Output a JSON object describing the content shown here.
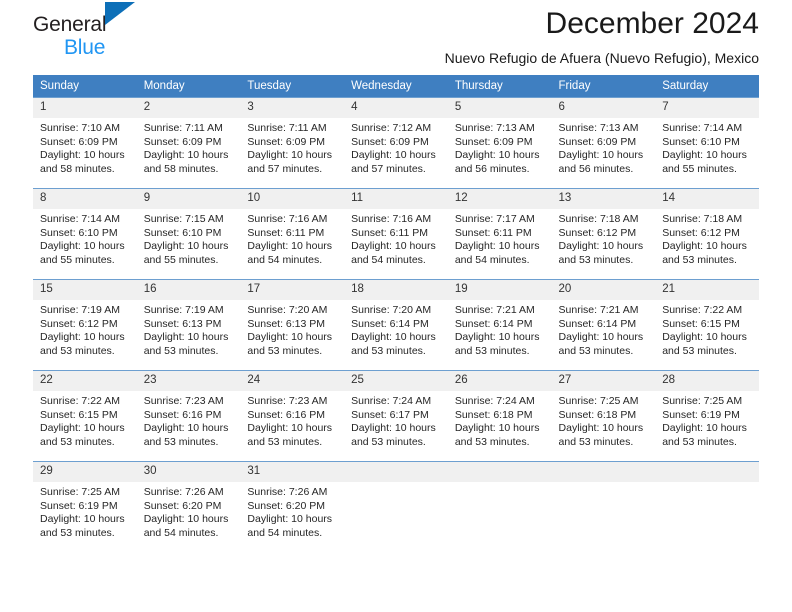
{
  "brand": {
    "line1": "General",
    "line2": "Blue",
    "accent_color": "#0d6fb8",
    "blue_color": "#2196f3"
  },
  "header": {
    "title": "December 2024",
    "subtitle": "Nuevo Refugio de Afuera (Nuevo Refugio), Mexico"
  },
  "calendar": {
    "header_color": "#3f7fc1",
    "weekday_headers": [
      "Sunday",
      "Monday",
      "Tuesday",
      "Wednesday",
      "Thursday",
      "Friday",
      "Saturday"
    ],
    "weeks": [
      [
        {
          "day": "1",
          "sunrise": "Sunrise: 7:10 AM",
          "sunset": "Sunset: 6:09 PM",
          "daylight": "Daylight: 10 hours and 58 minutes."
        },
        {
          "day": "2",
          "sunrise": "Sunrise: 7:11 AM",
          "sunset": "Sunset: 6:09 PM",
          "daylight": "Daylight: 10 hours and 58 minutes."
        },
        {
          "day": "3",
          "sunrise": "Sunrise: 7:11 AM",
          "sunset": "Sunset: 6:09 PM",
          "daylight": "Daylight: 10 hours and 57 minutes."
        },
        {
          "day": "4",
          "sunrise": "Sunrise: 7:12 AM",
          "sunset": "Sunset: 6:09 PM",
          "daylight": "Daylight: 10 hours and 57 minutes."
        },
        {
          "day": "5",
          "sunrise": "Sunrise: 7:13 AM",
          "sunset": "Sunset: 6:09 PM",
          "daylight": "Daylight: 10 hours and 56 minutes."
        },
        {
          "day": "6",
          "sunrise": "Sunrise: 7:13 AM",
          "sunset": "Sunset: 6:09 PM",
          "daylight": "Daylight: 10 hours and 56 minutes."
        },
        {
          "day": "7",
          "sunrise": "Sunrise: 7:14 AM",
          "sunset": "Sunset: 6:10 PM",
          "daylight": "Daylight: 10 hours and 55 minutes."
        }
      ],
      [
        {
          "day": "8",
          "sunrise": "Sunrise: 7:14 AM",
          "sunset": "Sunset: 6:10 PM",
          "daylight": "Daylight: 10 hours and 55 minutes."
        },
        {
          "day": "9",
          "sunrise": "Sunrise: 7:15 AM",
          "sunset": "Sunset: 6:10 PM",
          "daylight": "Daylight: 10 hours and 55 minutes."
        },
        {
          "day": "10",
          "sunrise": "Sunrise: 7:16 AM",
          "sunset": "Sunset: 6:11 PM",
          "daylight": "Daylight: 10 hours and 54 minutes."
        },
        {
          "day": "11",
          "sunrise": "Sunrise: 7:16 AM",
          "sunset": "Sunset: 6:11 PM",
          "daylight": "Daylight: 10 hours and 54 minutes."
        },
        {
          "day": "12",
          "sunrise": "Sunrise: 7:17 AM",
          "sunset": "Sunset: 6:11 PM",
          "daylight": "Daylight: 10 hours and 54 minutes."
        },
        {
          "day": "13",
          "sunrise": "Sunrise: 7:18 AM",
          "sunset": "Sunset: 6:12 PM",
          "daylight": "Daylight: 10 hours and 53 minutes."
        },
        {
          "day": "14",
          "sunrise": "Sunrise: 7:18 AM",
          "sunset": "Sunset: 6:12 PM",
          "daylight": "Daylight: 10 hours and 53 minutes."
        }
      ],
      [
        {
          "day": "15",
          "sunrise": "Sunrise: 7:19 AM",
          "sunset": "Sunset: 6:12 PM",
          "daylight": "Daylight: 10 hours and 53 minutes."
        },
        {
          "day": "16",
          "sunrise": "Sunrise: 7:19 AM",
          "sunset": "Sunset: 6:13 PM",
          "daylight": "Daylight: 10 hours and 53 minutes."
        },
        {
          "day": "17",
          "sunrise": "Sunrise: 7:20 AM",
          "sunset": "Sunset: 6:13 PM",
          "daylight": "Daylight: 10 hours and 53 minutes."
        },
        {
          "day": "18",
          "sunrise": "Sunrise: 7:20 AM",
          "sunset": "Sunset: 6:14 PM",
          "daylight": "Daylight: 10 hours and 53 minutes."
        },
        {
          "day": "19",
          "sunrise": "Sunrise: 7:21 AM",
          "sunset": "Sunset: 6:14 PM",
          "daylight": "Daylight: 10 hours and 53 minutes."
        },
        {
          "day": "20",
          "sunrise": "Sunrise: 7:21 AM",
          "sunset": "Sunset: 6:14 PM",
          "daylight": "Daylight: 10 hours and 53 minutes."
        },
        {
          "day": "21",
          "sunrise": "Sunrise: 7:22 AM",
          "sunset": "Sunset: 6:15 PM",
          "daylight": "Daylight: 10 hours and 53 minutes."
        }
      ],
      [
        {
          "day": "22",
          "sunrise": "Sunrise: 7:22 AM",
          "sunset": "Sunset: 6:15 PM",
          "daylight": "Daylight: 10 hours and 53 minutes."
        },
        {
          "day": "23",
          "sunrise": "Sunrise: 7:23 AM",
          "sunset": "Sunset: 6:16 PM",
          "daylight": "Daylight: 10 hours and 53 minutes."
        },
        {
          "day": "24",
          "sunrise": "Sunrise: 7:23 AM",
          "sunset": "Sunset: 6:16 PM",
          "daylight": "Daylight: 10 hours and 53 minutes."
        },
        {
          "day": "25",
          "sunrise": "Sunrise: 7:24 AM",
          "sunset": "Sunset: 6:17 PM",
          "daylight": "Daylight: 10 hours and 53 minutes."
        },
        {
          "day": "26",
          "sunrise": "Sunrise: 7:24 AM",
          "sunset": "Sunset: 6:18 PM",
          "daylight": "Daylight: 10 hours and 53 minutes."
        },
        {
          "day": "27",
          "sunrise": "Sunrise: 7:25 AM",
          "sunset": "Sunset: 6:18 PM",
          "daylight": "Daylight: 10 hours and 53 minutes."
        },
        {
          "day": "28",
          "sunrise": "Sunrise: 7:25 AM",
          "sunset": "Sunset: 6:19 PM",
          "daylight": "Daylight: 10 hours and 53 minutes."
        }
      ],
      [
        {
          "day": "29",
          "sunrise": "Sunrise: 7:25 AM",
          "sunset": "Sunset: 6:19 PM",
          "daylight": "Daylight: 10 hours and 53 minutes."
        },
        {
          "day": "30",
          "sunrise": "Sunrise: 7:26 AM",
          "sunset": "Sunset: 6:20 PM",
          "daylight": "Daylight: 10 hours and 54 minutes."
        },
        {
          "day": "31",
          "sunrise": "Sunrise: 7:26 AM",
          "sunset": "Sunset: 6:20 PM",
          "daylight": "Daylight: 10 hours and 54 minutes."
        },
        {
          "day": "",
          "sunrise": "",
          "sunset": "",
          "daylight": ""
        },
        {
          "day": "",
          "sunrise": "",
          "sunset": "",
          "daylight": ""
        },
        {
          "day": "",
          "sunrise": "",
          "sunset": "",
          "daylight": ""
        },
        {
          "day": "",
          "sunrise": "",
          "sunset": "",
          "daylight": ""
        }
      ]
    ]
  }
}
